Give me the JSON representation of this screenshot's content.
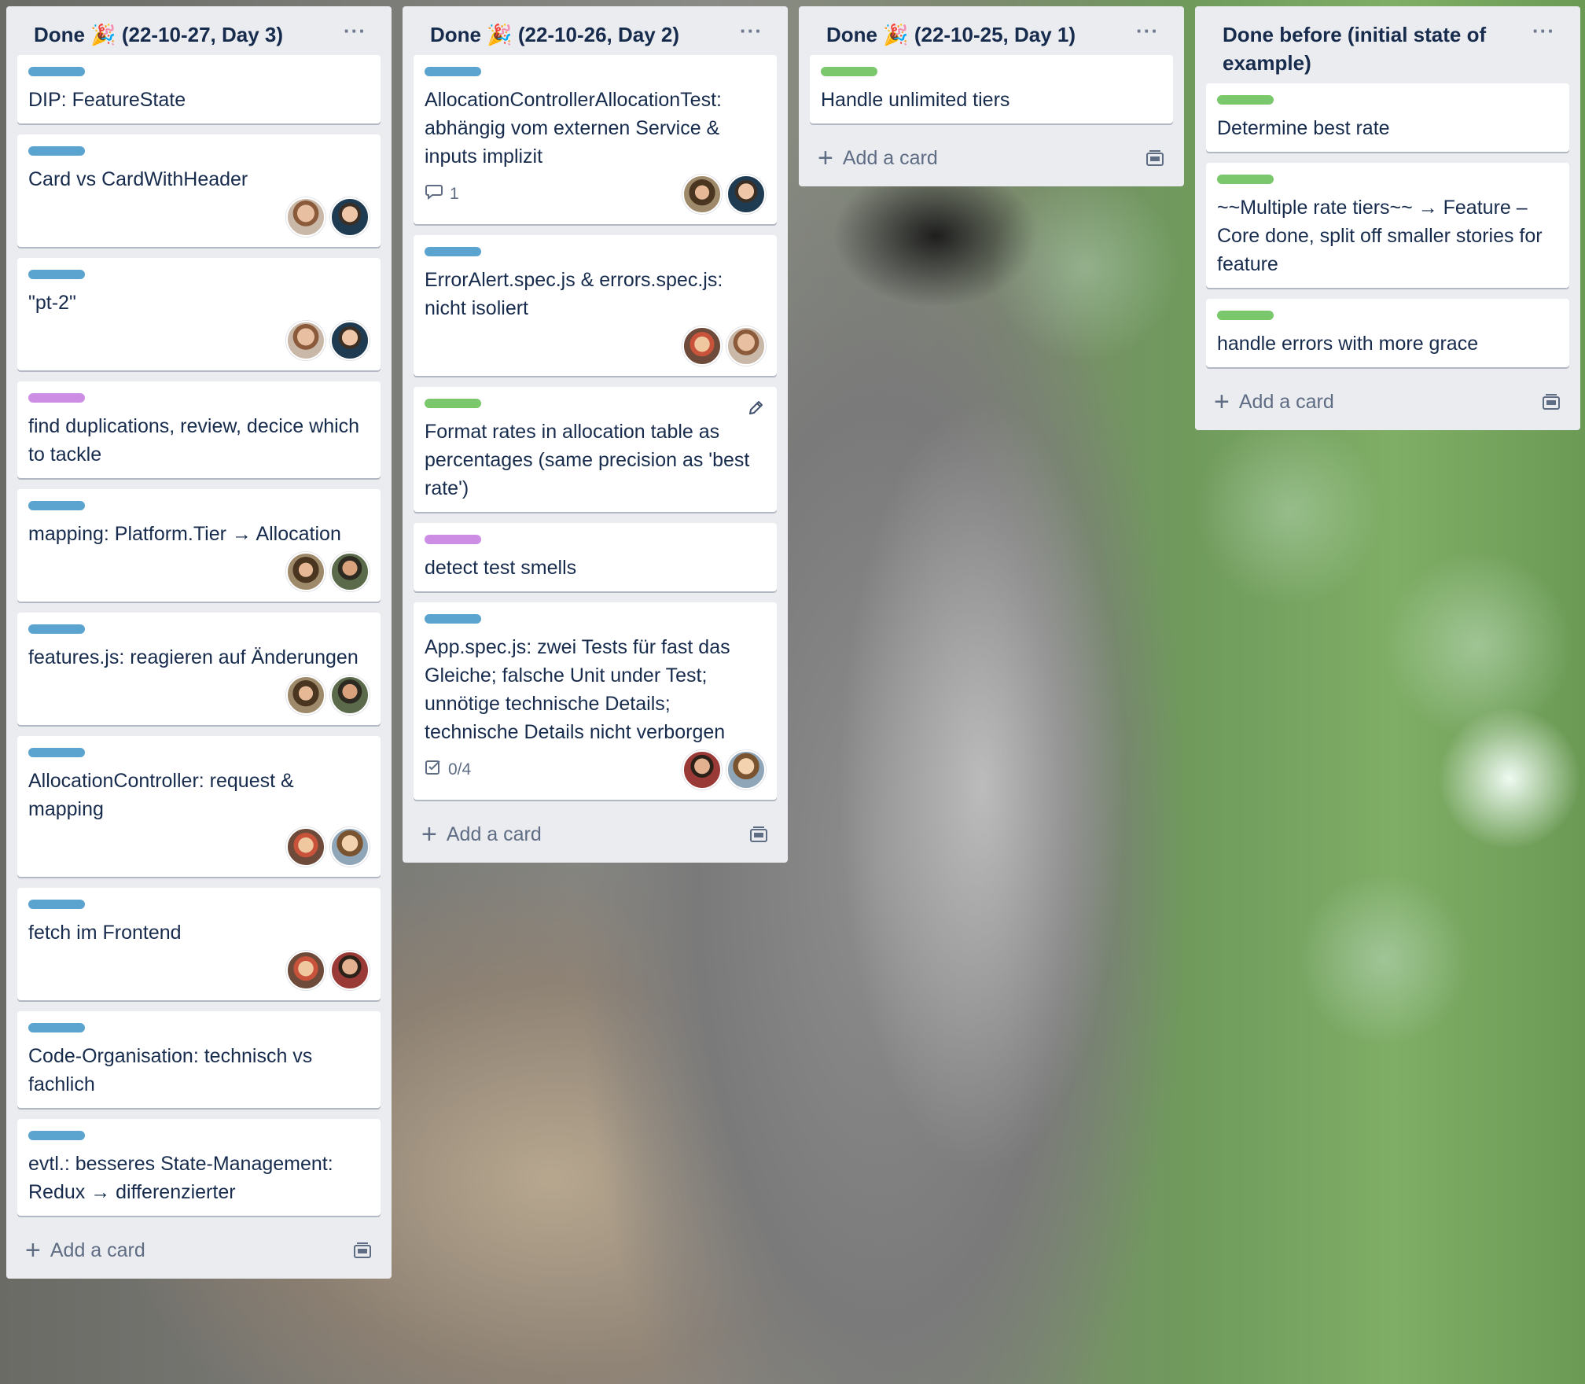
{
  "lists": [
    {
      "title": "Done 🎉 (22-10-27, Day 3)",
      "menu": "···",
      "add_card": "Add a card",
      "cards": [
        {
          "label": "blue",
          "title": "DIP: FeatureState",
          "avatars": []
        },
        {
          "label": "blue",
          "title": "Card vs CardWithHeader",
          "avatars": [
            "av1",
            "av2"
          ]
        },
        {
          "label": "blue",
          "title": "\"pt-2\"",
          "avatars": [
            "av1",
            "av2"
          ]
        },
        {
          "label": "purple",
          "title": "find duplications, review, decice which to tackle",
          "avatars": []
        },
        {
          "label": "blue",
          "title": "mapping: Platform.Tier → Allocation",
          "avatars": [
            "av3",
            "av4"
          ]
        },
        {
          "label": "blue",
          "title": "features.js: reagieren auf Änderungen",
          "avatars": [
            "av3",
            "av4"
          ]
        },
        {
          "label": "blue",
          "title": "AllocationController: request & mapping",
          "avatars": [
            "av5",
            "av6"
          ]
        },
        {
          "label": "blue",
          "title": "fetch im Frontend",
          "avatars": [
            "av5",
            "av7"
          ]
        },
        {
          "label": "blue",
          "title": "Code-Organisation: technisch vs fachlich",
          "avatars": []
        },
        {
          "label": "blue",
          "title": "evtl.: besseres State-Management: Redux → differenzierter",
          "avatars": []
        }
      ]
    },
    {
      "title": "Done 🎉 (22-10-26, Day 2)",
      "menu": "···",
      "add_card": "Add a card",
      "cards": [
        {
          "label": "blue",
          "title": "AllocationControllerAllocationTest: abhängig vom externen Service & inputs implizit",
          "badge": "1",
          "badge_icon": "comment-icon",
          "avatars": [
            "av3",
            "av2"
          ]
        },
        {
          "label": "blue",
          "title": "ErrorAlert.spec.js & errors.spec.js: nicht isoliert",
          "avatars": [
            "av5",
            "av1"
          ]
        },
        {
          "label": "green",
          "title": "Format rates in allocation table as percentages (same precision as 'best rate')",
          "avatars": [],
          "edit": true
        },
        {
          "label": "purple",
          "title": "detect test smells",
          "avatars": []
        },
        {
          "label": "blue",
          "title": "App.spec.js: zwei Tests für fast das Gleiche; falsche Unit under Test; unnötige technische Details; technische Details nicht verborgen",
          "badge": "0/4",
          "badge_icon": "checklist-icon",
          "avatars": [
            "av7",
            "av6"
          ]
        }
      ]
    },
    {
      "title": "Done 🎉 (22-10-25, Day 1)",
      "menu": "···",
      "add_card": "Add a card",
      "cards": [
        {
          "label": "green",
          "title": "Handle unlimited tiers",
          "avatars": []
        }
      ]
    },
    {
      "title": "Done before (initial state of example)",
      "menu": "···",
      "add_card": "Add a card",
      "cards": [
        {
          "label": "green",
          "title": "Determine best rate",
          "avatars": []
        },
        {
          "label": "green",
          "title": "~~Multiple rate tiers~~ → Feature – Core done, split off smaller stories for feature",
          "avatars": []
        },
        {
          "label": "green",
          "title": "handle errors with more grace",
          "avatars": []
        }
      ]
    }
  ]
}
